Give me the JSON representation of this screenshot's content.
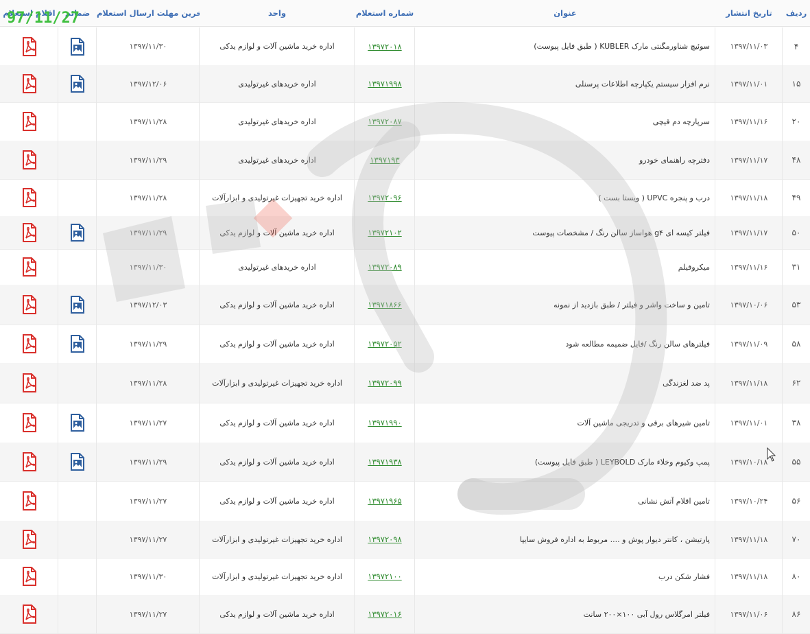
{
  "overlay_date": "97/11/27",
  "headers": {
    "radif": "ردیف",
    "tarikh": "تاریخ انتشار",
    "onvan": "عنوان",
    "shomare": "شماره استعلام",
    "vahed": "واحد",
    "mohlat": "آخرین مهلت ارسال استعلام",
    "zamaem": "ضمائم",
    "aghlam": "اقلام استعلام"
  },
  "rows": [
    {
      "radif": "۴",
      "date": "۱۳۹۷/۱۱/۰۳",
      "title": "سوئیچ شناورمگنتی مارک KUBLER ( طبق فایل پیوست)",
      "num": "۱۳۹۷۲۰۱۸",
      "unit": "اداره خرید ماشین آلات و لوازم یدکی",
      "deadline": "۱۳۹۷/۱۱/۳۰",
      "has_image": true
    },
    {
      "radif": "۱۵",
      "date": "۱۳۹۷/۱۱/۰۱",
      "title": "نرم افزار سیستم یکپارچه اطلاعات پرسنلی",
      "num": "۱۳۹۷۱۹۹۸",
      "unit": "اداره خریدهای غیرتولیدی",
      "deadline": "۱۳۹۷/۱۲/۰۶",
      "has_image": true
    },
    {
      "radif": "۲۰",
      "date": "۱۳۹۷/۱۱/۱۶",
      "title": "سرپارچه دم قیچی",
      "num": "۱۳۹۷۲۰۸۷",
      "unit": "اداره خریدهای غیرتولیدی",
      "deadline": "۱۳۹۷/۱۱/۲۸",
      "has_image": false
    },
    {
      "radif": "۴۸",
      "date": "۱۳۹۷/۱۱/۱۷",
      "title": "دفترچه راهنمای خودرو",
      "num": "۱۳۹۷۱۹۳",
      "unit": "اداره خریدهای غیرتولیدی",
      "deadline": "۱۳۹۷/۱۱/۲۹",
      "has_image": false
    },
    {
      "radif": "۴۹",
      "date": "۱۳۹۷/۱۱/۱۸",
      "title": "درب و پنجره UPVC ( ویستا بست )",
      "num": "۱۳۹۷۲۰۹۶",
      "unit": "اداره خرید تجهیزات غیرتولیدی و ابزارآلات",
      "deadline": "۱۳۹۷/۱۱/۲۸",
      "has_image": false
    },
    {
      "radif": "۵۰",
      "date": "۱۳۹۷/۱۱/۱۷",
      "title": "فیلتر کیسه ای g۴ هواساز سالن رنگ / مشخصات پیوست",
      "num": "۱۳۹۷۲۱۰۲",
      "unit": "اداره خرید ماشین آلات و لوازم یدکی",
      "deadline": "۱۳۹۷/۱۱/۲۹",
      "has_image": true
    },
    {
      "radif": "۳۱",
      "date": "۱۳۹۷/۱۱/۱۶",
      "title": "میکروفیلم",
      "num": "۱۳۹۷۲۰۸۹",
      "unit": "اداره خریدهای غیرتولیدی",
      "deadline": "۱۳۹۷/۱۱/۳۰",
      "has_image": false
    },
    {
      "radif": "۵۳",
      "date": "۱۳۹۷/۱۰/۰۶",
      "title": "تامین و ساخت واشر و فیلتر / طبق بازدید از نمونه",
      "num": "۱۳۹۷۱۸۶۶",
      "unit": "اداره خرید ماشین آلات و لوازم یدکی",
      "deadline": "۱۳۹۷/۱۲/۰۳",
      "has_image": true
    },
    {
      "radif": "۵۸",
      "date": "۱۳۹۷/۱۱/۰۹",
      "title": "فیلترهای سالن رنگ /فایل ضمیمه مطالعه شود",
      "num": "۱۳۹۷۲۰۵۲",
      "unit": "اداره خرید ماشین آلات و لوازم یدکی",
      "deadline": "۱۳۹۷/۱۱/۲۹",
      "has_image": true
    },
    {
      "radif": "۶۲",
      "date": "۱۳۹۷/۱۱/۱۸",
      "title": "پد ضد لغزندگی",
      "num": "۱۳۹۷۲۰۹۹",
      "unit": "اداره خرید تجهیزات غیرتولیدی و ابزارآلات",
      "deadline": "۱۳۹۷/۱۱/۲۸",
      "has_image": false
    },
    {
      "radif": "۳۸",
      "date": "۱۳۹۷/۱۱/۰۱",
      "title": "تامین شیرهای برقی و تدریجی ماشین آلات",
      "num": "۱۳۹۷۱۹۹۰",
      "unit": "اداره خرید ماشین آلات و لوازم یدکی",
      "deadline": "۱۳۹۷/۱۱/۲۷",
      "has_image": true
    },
    {
      "radif": "۵۵",
      "date": "۱۳۹۷/۱۰/۱۸",
      "title": "پمپ وکیوم وخلاء مارک LEYBOLD ( طبق فایل پیوست)",
      "num": "۱۳۹۷۱۹۳۸",
      "unit": "اداره خرید ماشین آلات و لوازم یدکی",
      "deadline": "۱۳۹۷/۱۱/۲۹",
      "has_image": true
    },
    {
      "radif": "۵۶",
      "date": "۱۳۹۷/۱۰/۲۴",
      "title": "تامین اقلام آتش نشانی",
      "num": "۱۳۹۷۱۹۶۵",
      "unit": "اداره خرید ماشین آلات و لوازم یدکی",
      "deadline": "۱۳۹۷/۱۱/۲۷",
      "has_image": false
    },
    {
      "radif": "۷۰",
      "date": "۱۳۹۷/۱۱/۱۸",
      "title": "پارتیشن ، کانتر دیوار پوش و .... مربوط به اداره فروش سایپا",
      "num": "۱۳۹۷۲۰۹۸",
      "unit": "اداره خرید تجهیزات غیرتولیدی و ابزارآلات",
      "deadline": "۱۳۹۷/۱۱/۲۷",
      "has_image": false
    },
    {
      "radif": "۸۰",
      "date": "۱۳۹۷/۱۱/۱۸",
      "title": "فشار شکن درب",
      "num": "۱۳۹۷۲۱۰۰",
      "unit": "اداره خرید تجهیزات غیرتولیدی و ابزارآلات",
      "deadline": "۱۳۹۷/۱۱/۳۰",
      "has_image": false
    },
    {
      "radif": "۸۶",
      "date": "۱۳۹۷/۱۱/۰۶",
      "title": "فیلتر امرگلاس رول آبی ۱۰۰×۲۰۰ سانت",
      "num": "۱۳۹۷۲۰۱۶",
      "unit": "اداره خرید ماشین آلات و لوازم یدکی",
      "deadline": "۱۳۹۷/۱۱/۲۷",
      "has_image": false
    }
  ],
  "colors": {
    "header_text": "#3f6fb5",
    "link": "#2e8b2e",
    "pdf": "#d9302c",
    "image_icon": "#2f5f9e",
    "overlay": "#3fbf3f"
  },
  "icons": {
    "attachment": "image-icon",
    "items": "pdf-icon"
  }
}
